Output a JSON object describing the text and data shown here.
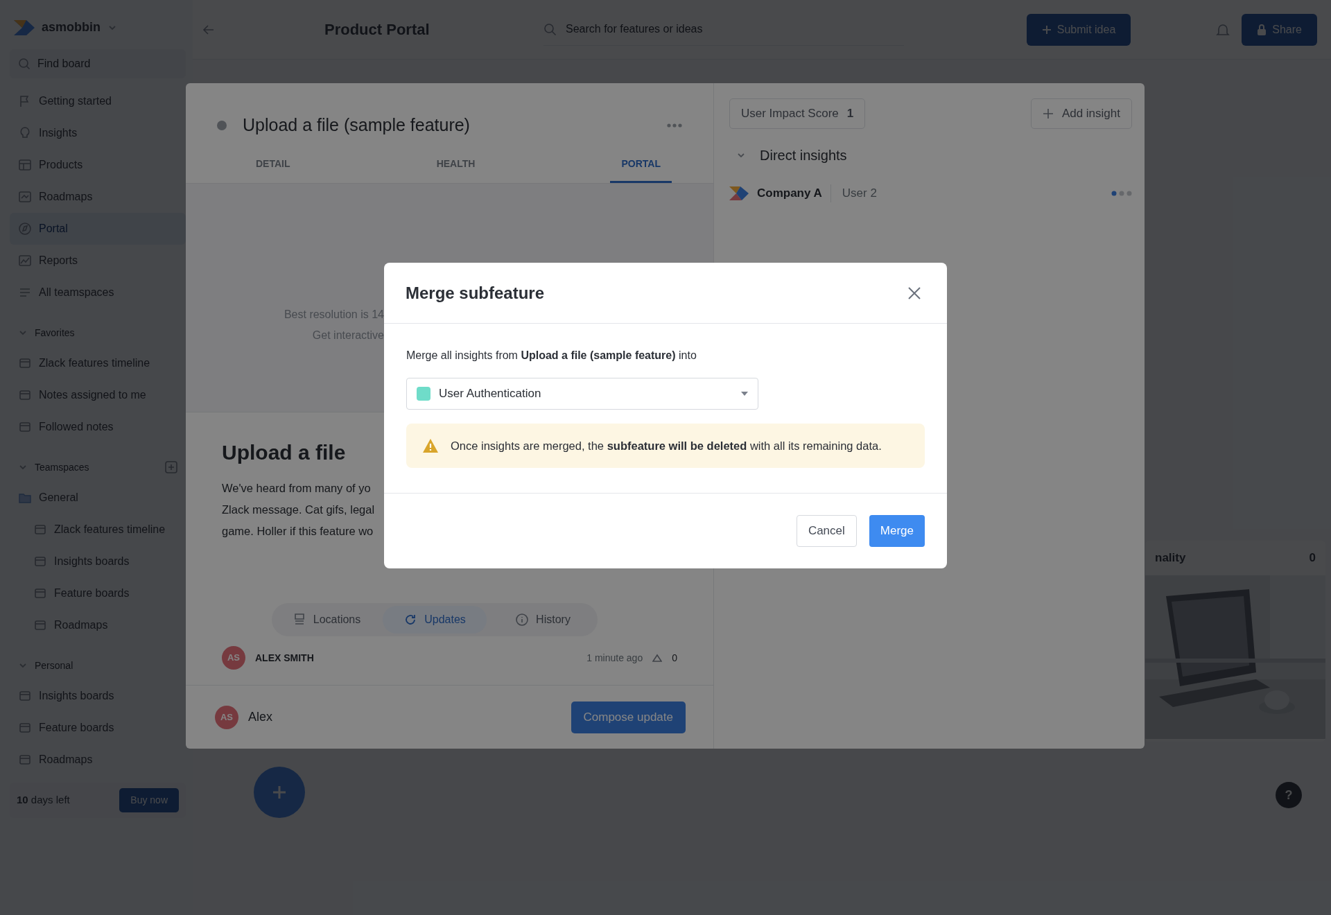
{
  "sidebar": {
    "workspace": "asmobbin",
    "find_placeholder": "Find board",
    "nav": [
      {
        "label": "Getting started",
        "selected": false
      },
      {
        "label": "Insights",
        "selected": false
      },
      {
        "label": "Products",
        "selected": false
      },
      {
        "label": "Roadmaps",
        "selected": false
      },
      {
        "label": "Portal",
        "selected": true
      },
      {
        "label": "Reports",
        "selected": false
      },
      {
        "label": "All teamspaces",
        "selected": false
      }
    ],
    "sections": [
      {
        "title": "Favorites",
        "expanded": true,
        "items": [
          {
            "label": "Zlack features timeline"
          },
          {
            "label": "Notes assigned to me"
          },
          {
            "label": "Followed notes"
          }
        ]
      },
      {
        "title": "Teamspaces",
        "expanded": true,
        "items": [
          {
            "label": "General",
            "children": [
              {
                "label": "Zlack features timeline"
              },
              {
                "label": "Insights boards"
              },
              {
                "label": "Feature boards"
              },
              {
                "label": "Roadmaps"
              }
            ]
          }
        ]
      },
      {
        "title": "Personal",
        "expanded": true,
        "items": [
          {
            "label": "Insights boards"
          },
          {
            "label": "Feature boards"
          },
          {
            "label": "Roadmaps"
          }
        ]
      }
    ],
    "trial": {
      "days": "10",
      "text": "days left",
      "button": "Buy now"
    }
  },
  "topbar": {
    "title": "Product Portal",
    "search_placeholder": "Search for features or ideas",
    "submit_button": "Submit idea",
    "share_button": "Share"
  },
  "background_card": {
    "title": "nality",
    "votes": "0",
    "kind": "picture"
  },
  "help": "?",
  "feature": {
    "title": "Upload a file (sample feature)",
    "tabs": [
      {
        "label": "DETAIL",
        "selected": false
      },
      {
        "label": "HEALTH",
        "selected": false
      },
      {
        "label": "PORTAL",
        "selected": true
      }
    ],
    "preview_lines": [
      "Best resolution is 14",
      "Get interactive"
    ],
    "heading": "Upload a file",
    "description_lines": [
      "We've heard from many of yo",
      "Zlack message. Cat gifs, legal",
      "game. Holler if this feature wo"
    ],
    "subtabs": [
      {
        "label": "Locations",
        "selected": false
      },
      {
        "label": "Updates",
        "selected": true
      },
      {
        "label": "History",
        "selected": false
      }
    ],
    "update": {
      "initials": "AS",
      "author": "ALEX SMITH",
      "time": "1 minute ago",
      "votes": "0"
    },
    "composer": {
      "initials": "AS",
      "name": "Alex",
      "button": "Compose update"
    }
  },
  "insights": {
    "score_label": "User Impact Score",
    "score": "1",
    "add_button": "Add insight",
    "group": {
      "title": "Direct insights",
      "expanded": true,
      "items": [
        {
          "company": "Company A",
          "user": "User 2"
        }
      ]
    }
  },
  "dialog": {
    "title": "Merge subfeature",
    "message": "Merge all insights from **Upload a file (sample feature)** into",
    "select": {
      "value": "User Authentication",
      "color": "#6fdcc9"
    },
    "warning": "Once insights are merged, the **subfeature will be deleted** with all its remaining data.",
    "buttons": [
      {
        "label": "Cancel",
        "kind": "secondary"
      },
      {
        "label": "Merge",
        "kind": "primary"
      }
    ]
  }
}
